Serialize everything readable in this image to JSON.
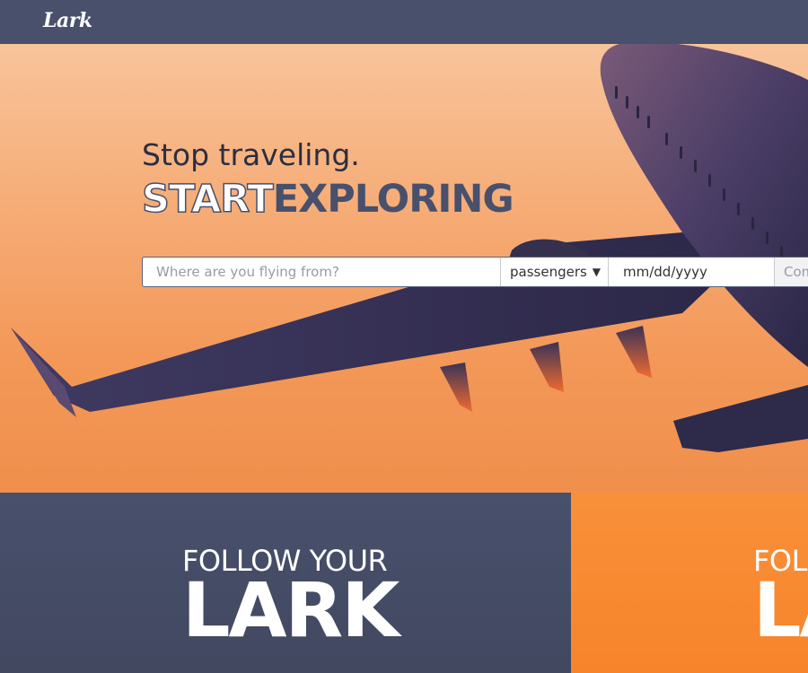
{
  "header": {
    "logo": "Lark"
  },
  "hero": {
    "tagline": "Stop traveling.",
    "headline_start": "START",
    "headline_explore": "EXPLORING"
  },
  "search": {
    "from_placeholder": "Where are you flying from?",
    "passengers_label": "passengers",
    "date_placeholder": "mm/dd/yyyy",
    "extra_partial": "Com"
  },
  "promos": [
    {
      "line1": "FOLLOW YOUR",
      "line2": "LARK"
    },
    {
      "line1": "FOL",
      "line2": "LA"
    }
  ],
  "colors": {
    "navy": "#48506c",
    "orange": "#f7842a",
    "white": "#ffffff"
  },
  "icons": {
    "dropdown": "caret-down-icon"
  }
}
